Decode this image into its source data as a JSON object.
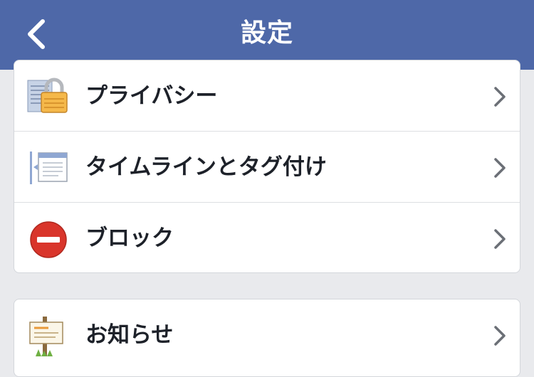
{
  "header": {
    "title": "設定",
    "back_icon": "chevron-left-icon"
  },
  "settings_group_1": {
    "items": [
      {
        "label": "プライバシー",
        "icon": "padlock-icon"
      },
      {
        "label": "タイムラインとタグ付け",
        "icon": "timeline-icon"
      },
      {
        "label": "ブロック",
        "icon": "block-icon"
      }
    ]
  },
  "settings_group_2": {
    "items": [
      {
        "label": "お知らせ",
        "icon": "signpost-icon"
      }
    ]
  },
  "colors": {
    "navbar": "#4e68a8",
    "background": "#e9eaed",
    "block_red": "#d9352b",
    "chevron": "#6b6f76"
  }
}
